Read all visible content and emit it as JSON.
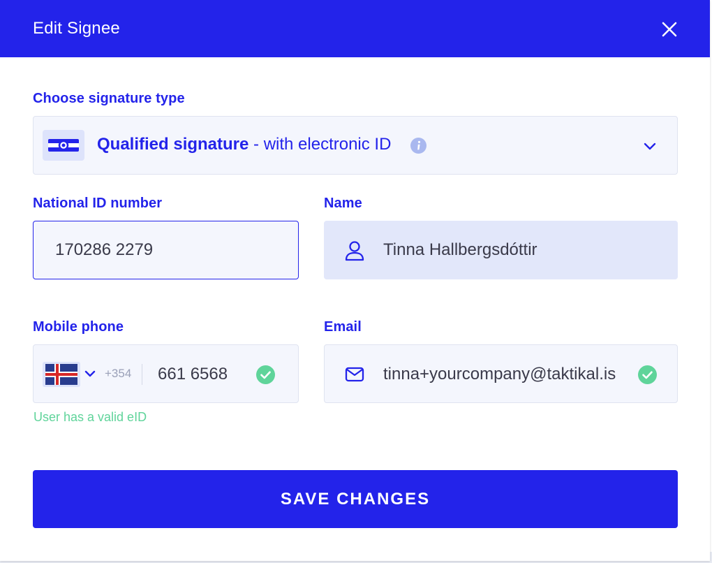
{
  "dialog": {
    "title": "Edit Signee",
    "close_icon": "close-icon"
  },
  "signature_type": {
    "label": "Choose signature type",
    "selected_bold": "Qualified signature",
    "selected_rest": " - with electronic ID",
    "icon": "id-card-icon",
    "info_icon": "info-icon",
    "dropdown_icon": "chevron-down-icon"
  },
  "national_id": {
    "label": "National ID number",
    "value": "170286 2279"
  },
  "name": {
    "label": "Name",
    "value": "Tinna Hallbergsdóttir",
    "icon": "person-icon"
  },
  "mobile_phone": {
    "label": "Mobile phone",
    "country_flag": "iceland-flag-icon",
    "dial_code": "+354",
    "value": "661 6568",
    "status_icon": "check-circle-icon",
    "note": "User has a valid eID"
  },
  "email": {
    "label": "Email",
    "value": "tinna+yourcompany@taktikal.is",
    "icon": "mail-icon",
    "status_icon": "check-circle-icon"
  },
  "actions": {
    "save_label": "SAVE CHANGES"
  },
  "colors": {
    "primary": "#2323ea",
    "field_bg": "#f4f6fd",
    "readonly_bg": "#e2e7fa",
    "success": "#5fd49a"
  }
}
